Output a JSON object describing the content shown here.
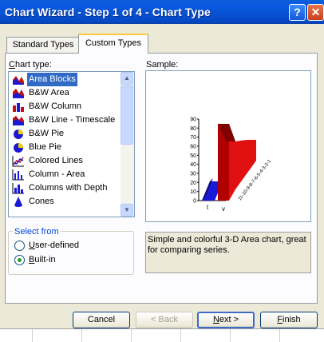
{
  "window": {
    "title": "Chart Wizard - Step 1 of 4 - Chart Type",
    "help_glyph": "?",
    "close_glyph": "✕"
  },
  "tabs": [
    {
      "label": "Standard Types",
      "active": false
    },
    {
      "label": "Custom Types",
      "active": true
    }
  ],
  "chart_type": {
    "label_prefix": "",
    "label_accel": "C",
    "label_rest": "hart type:",
    "items": [
      {
        "label": "Area Blocks",
        "icon": "area-blocks-icon",
        "selected": true
      },
      {
        "label": "B&W Area",
        "icon": "bw-area-icon",
        "selected": false
      },
      {
        "label": "B&W Column",
        "icon": "bw-column-icon",
        "selected": false
      },
      {
        "label": "B&W Line - Timescale",
        "icon": "bw-line-timescale-icon",
        "selected": false
      },
      {
        "label": "B&W Pie",
        "icon": "bw-pie-icon",
        "selected": false
      },
      {
        "label": "Blue Pie",
        "icon": "blue-pie-icon",
        "selected": false
      },
      {
        "label": "Colored Lines",
        "icon": "colored-lines-icon",
        "selected": false
      },
      {
        "label": "Column - Area",
        "icon": "column-area-icon",
        "selected": false
      },
      {
        "label": "Columns with Depth",
        "icon": "columns-with-depth-icon",
        "selected": false
      },
      {
        "label": "Cones",
        "icon": "cones-icon",
        "selected": false
      }
    ]
  },
  "sample": {
    "label": "Sample:",
    "y_ticks": [
      "90",
      "80",
      "70",
      "60",
      "50",
      "40",
      "30",
      "20",
      "10",
      "0"
    ],
    "x_labels": [
      "t",
      "v"
    ],
    "depth_labels": "11-10-9-8-7-6-5-4-3-2-1"
  },
  "select_from": {
    "title": "Select from",
    "options": [
      {
        "accel": "U",
        "rest": "ser-defined",
        "checked": false
      },
      {
        "accel": "B",
        "rest": "uilt-in",
        "checked": true
      }
    ]
  },
  "description": "Simple and colorful 3-D Area chart, great for comparing series.",
  "buttons": {
    "cancel": "Cancel",
    "back": "< Back",
    "next_accel": "N",
    "next_rest": "ext >",
    "finish_accel": "F",
    "finish_rest": "inish"
  },
  "colors": {
    "title_bar": "#0753d8",
    "selection": "#316ac5",
    "series_blue": "#1a1ad6",
    "series_red": "#e01010"
  }
}
